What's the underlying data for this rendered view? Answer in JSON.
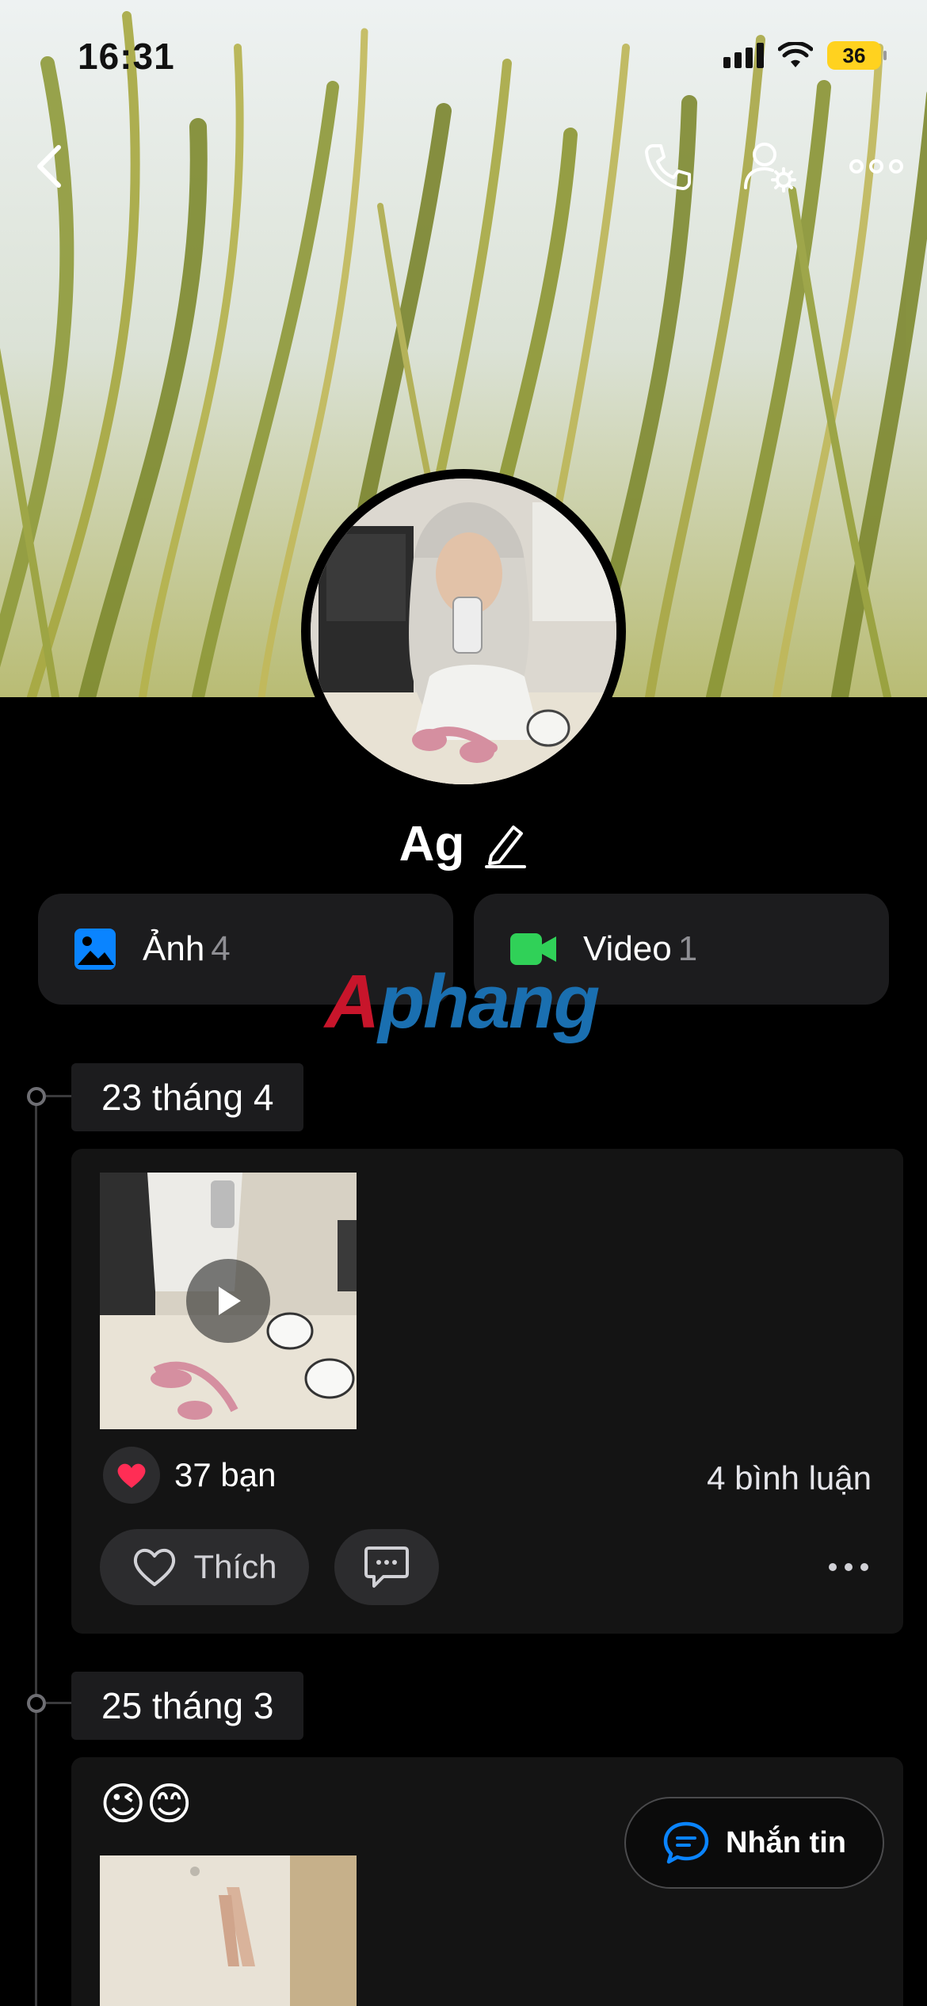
{
  "status_bar": {
    "time": "16:31",
    "battery": "36"
  },
  "profile": {
    "name": "Ag"
  },
  "media": {
    "photos": {
      "label": "Ảnh",
      "count": "4"
    },
    "videos": {
      "label": "Video",
      "count": "1"
    }
  },
  "watermark": {
    "part1": "A",
    "part2": "phang"
  },
  "posts": [
    {
      "date": "23 tháng 4",
      "likes": "37 bạn",
      "comments": "4 bình luận",
      "like_label": "Thích"
    },
    {
      "date": "25 tháng 3",
      "emojis": "😉😊"
    }
  ],
  "fab": {
    "label": "Nhắn tin"
  },
  "colors": {
    "accent": "#0a84ff",
    "video_green": "#30d158",
    "heart": "#ff2d55"
  }
}
